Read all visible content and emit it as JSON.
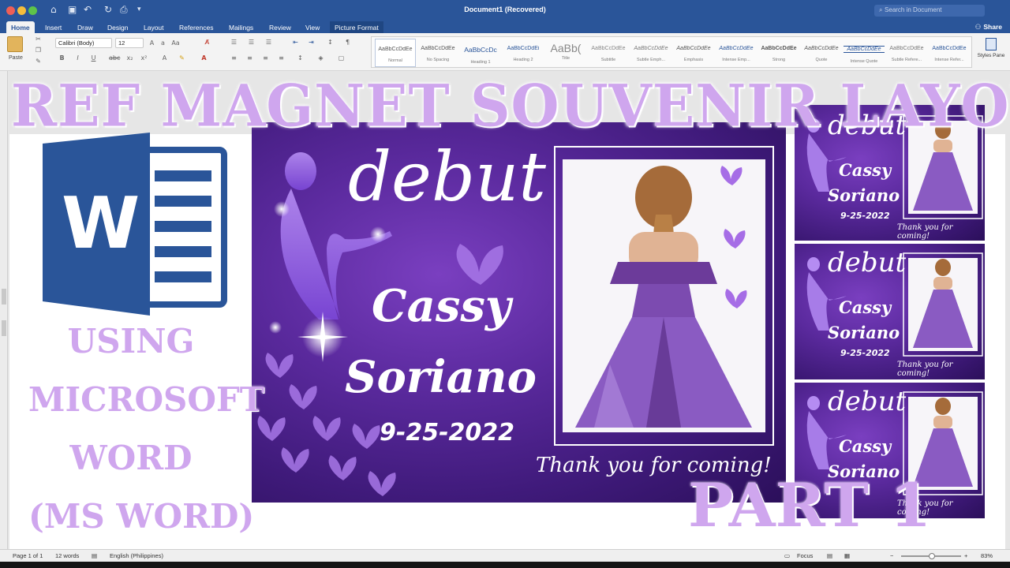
{
  "window": {
    "title": "Document1 (Recovered)",
    "search_placeholder": "Search in Document",
    "share_label": "Share"
  },
  "tabs": [
    "Home",
    "Insert",
    "Draw",
    "Design",
    "Layout",
    "References",
    "Mailings",
    "Review",
    "View",
    "Picture Format"
  ],
  "ribbon": {
    "paste_label": "Paste",
    "font_name": "Calibri (Body)",
    "font_size": "12",
    "styles": [
      {
        "sample": "AaBbCcDdEe",
        "name": "Normal"
      },
      {
        "sample": "AaBbCcDdEe",
        "name": "No Spacing"
      },
      {
        "sample": "AaBbCcDc",
        "name": "Heading 1"
      },
      {
        "sample": "AaBbCcDdEi",
        "name": "Heading 2"
      },
      {
        "sample": "AaBb(",
        "name": "Title"
      },
      {
        "sample": "AaBbCcDdEe",
        "name": "Subtitle"
      },
      {
        "sample": "AaBbCcDdEe",
        "name": "Subtle Emph..."
      },
      {
        "sample": "AaBbCcDdEe",
        "name": "Emphasis"
      },
      {
        "sample": "AaBbCcDdEe",
        "name": "Intense Emp..."
      },
      {
        "sample": "AaBbCcDdEe",
        "name": "Strong"
      },
      {
        "sample": "AaBbCcDdEe",
        "name": "Quote"
      },
      {
        "sample": "AaBbCcDdEe",
        "name": "Intense Quote"
      },
      {
        "sample": "AaBbCcDdEe",
        "name": "Subtle Refere..."
      },
      {
        "sample": "AaBbCcDdEe",
        "name": "Intense Refer..."
      }
    ],
    "styles_pane_label": "Styles Pane"
  },
  "overlay": {
    "headline": "REF MAGNET SOUVENIR LAYOUT",
    "side_lines": [
      "USING",
      "MICROSOFT",
      "WORD",
      "(MS WORD)"
    ],
    "part": "PART 1"
  },
  "card": {
    "script_title": "debut",
    "first_name": "Cassy",
    "last_name": "Soriano",
    "date": "9-25-2022",
    "thanks": "Thank you for coming!"
  },
  "status": {
    "page": "Page 1 of 1",
    "words": "12 words",
    "language": "English (Philippines)",
    "focus": "Focus",
    "zoom": "83%"
  },
  "colors": {
    "word_blue": "#2a5599",
    "overlay_lilac": "#cfa6ee",
    "card_purple": "#5b2a9e"
  }
}
